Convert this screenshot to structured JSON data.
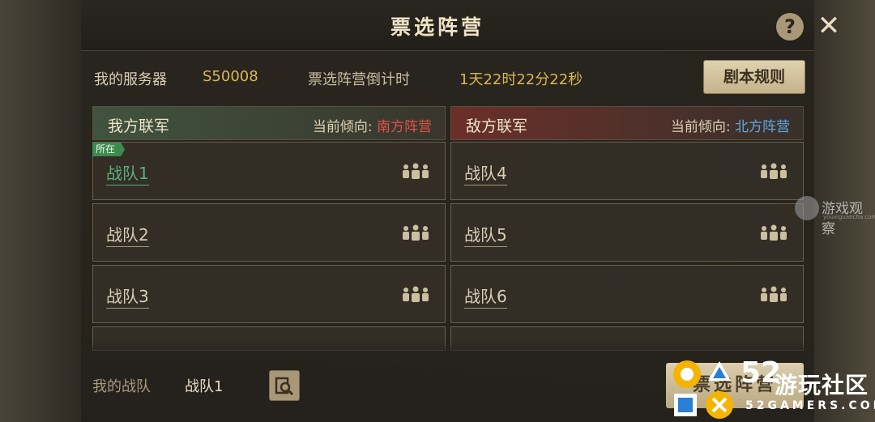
{
  "title": "票选阵营",
  "header": {
    "help_label": "?",
    "close_label": "✕"
  },
  "info": {
    "server_label": "我的服务器",
    "server_value": "S50008",
    "countdown_label": "票选阵营倒计时",
    "countdown_value": "1天22时22分22秒",
    "rules_button": "剧本规则"
  },
  "left_column": {
    "name": "我方联军",
    "lean_label": "当前倾向:",
    "lean_value": "南方阵营",
    "current_tag": "所在",
    "teams": [
      "战队1",
      "战队2",
      "战队3"
    ]
  },
  "right_column": {
    "name": "敌方联军",
    "lean_label": "当前倾向:",
    "lean_value": "北方阵营",
    "teams": [
      "战队4",
      "战队5",
      "战队6"
    ]
  },
  "bottom": {
    "my_team_label": "我的战队",
    "my_team_value": "战队1",
    "confirm_button": "票选阵营"
  },
  "watermarks": {
    "site_name": "游戏观察",
    "site_sub": "youxiguancha.com",
    "logo_number": "52",
    "logo_cn": "游玩社区",
    "logo_en": "52GAMERS.COM"
  },
  "colors": {
    "south": "#e0524a",
    "north": "#5ea8e0",
    "mine": "#58b07a",
    "gold": "#d9b650"
  },
  "icons": {
    "team_members": "people-group-icon",
    "search": "magnifier-icon"
  }
}
